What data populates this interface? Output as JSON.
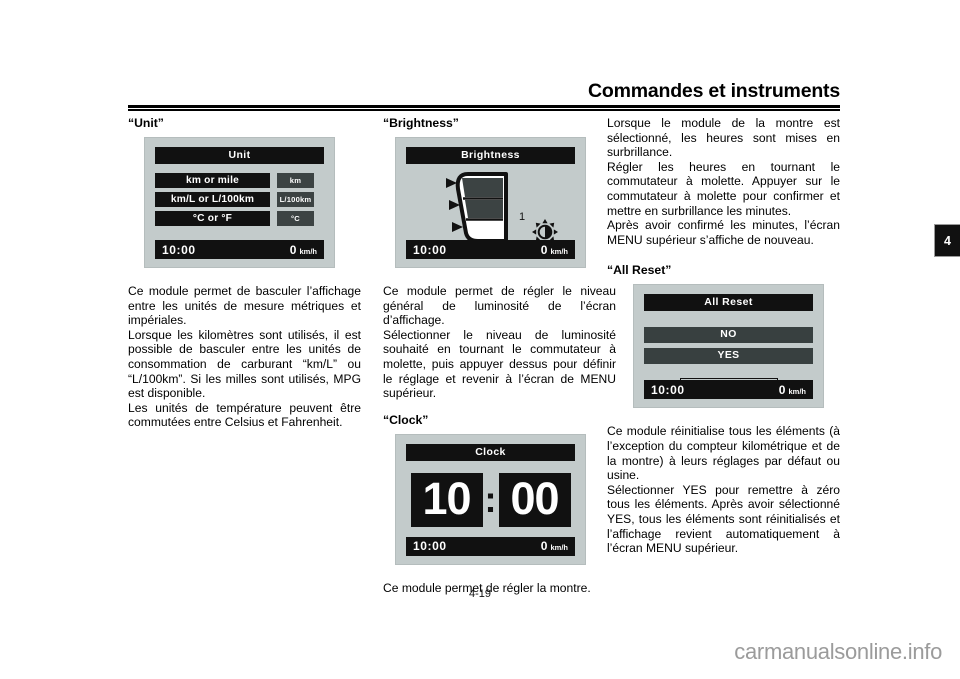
{
  "header": {
    "title": "Commandes et instruments",
    "chapter_tab": "4"
  },
  "page": {
    "number": "4-19",
    "watermark": "carmanualsonline.info"
  },
  "colors": {
    "screen_background": "#c3cbcb",
    "screen_panel_dark": "#111111",
    "screen_value_chip": "#3c4343",
    "screen_option": "#384040",
    "text": "#000000",
    "watermark": "#9b9b9b"
  },
  "columns": {
    "left": {
      "heading": "“Unit”",
      "screen": {
        "name": "unit-screen",
        "title": "Unit",
        "rows": [
          {
            "label": "km or mile",
            "value": "km"
          },
          {
            "label": "km/L or L/100km",
            "value": "L/100km"
          },
          {
            "label": "°C or °F",
            "value": "°C"
          }
        ],
        "up_button_icon": "triangle-up-icon",
        "status": {
          "clock": "10:00",
          "speed": "0",
          "speed_unit": "km/h"
        }
      },
      "paragraphs": [
        "Ce module permet de basculer l’affichage entre les unités de mesure métriques et impériales.",
        "Lorsque les kilomètres sont utilisés, il est possible de basculer entre les unités de consommation de carburant “km/L” ou “L/100km”. Si les milles sont utilisés, MPG est disponible.",
        "Les unités de température peuvent être commutées entre Celsius et Fahrenheit."
      ]
    },
    "middle": {
      "heading_brightness": "“Brightness”",
      "brightness_screen": {
        "name": "brightness-screen",
        "title": "Brightness",
        "level_number": "1",
        "sun_icon": "brightness-sun-icon",
        "bar_icon": "brightness-level-bar",
        "status": {
          "clock": "10:00",
          "speed": "0",
          "speed_unit": "km/h"
        }
      },
      "paragraphs": [
        "Ce module permet de régler le niveau général de luminosité de l’écran d’affichage.",
        "Sélectionner le niveau de luminosité souhaité en tournant le commutateur à molette, puis appuyer dessus pour définir le réglage et revenir à l’écran de MENU supérieur."
      ],
      "heading_clock": "“Clock”",
      "clock_screen": {
        "name": "clock-screen",
        "title": "Clock",
        "hours": "10",
        "separator": ":",
        "minutes": "00",
        "status": {
          "clock": "10:00",
          "speed": "0",
          "speed_unit": "km/h"
        }
      },
      "closing_paragraph": "Ce module permet de régler la montre."
    },
    "right": {
      "paragraphs_top": [
        "Lorsque le module de la montre est sélectionné, les heures sont mises en surbrillance.",
        "Régler les heures en tournant le commutateur à molette. Appuyer sur le commutateur à molette pour confirmer et mettre en surbrillance les minutes.",
        "Après avoir confirmé les minutes, l’écran MENU supérieur s’affiche de nouveau."
      ],
      "heading_all_reset": "“All Reset”",
      "reset_screen": {
        "name": "all-reset-screen",
        "title": "All Reset",
        "options": [
          "NO",
          "YES"
        ],
        "up_button_icon": "triangle-up-icon",
        "status": {
          "clock": "10:00",
          "speed": "0",
          "speed_unit": "km/h"
        }
      },
      "paragraphs_bottom": [
        "Ce module réinitialise tous les éléments (à l’exception du compteur kilométrique et de la montre) à leurs réglages par défaut ou usine.",
        "Sélectionner YES pour remettre à zéro tous les éléments. Après avoir sélectionné YES, tous les éléments sont réinitialisés et l’affichage revient automatiquement à l’écran MENU supérieur."
      ]
    }
  }
}
